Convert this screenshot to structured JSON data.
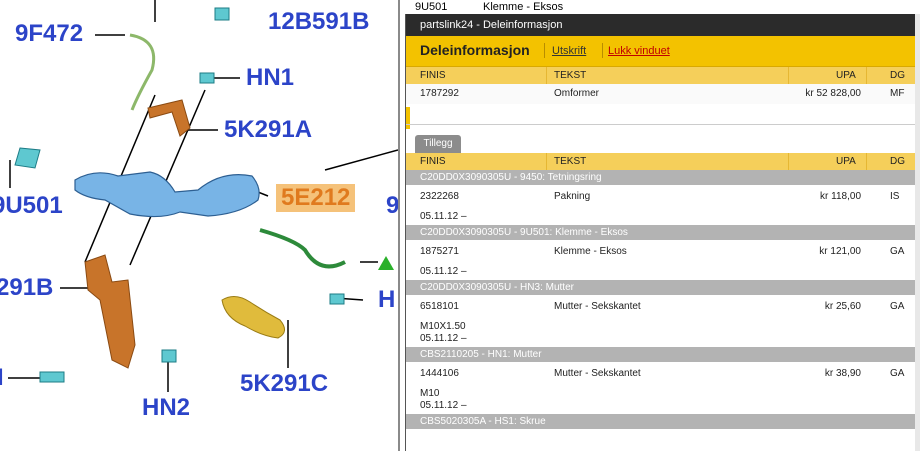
{
  "diagram": {
    "labels": {
      "9f472": "9F472",
      "12b591b": "12B591B",
      "hn1": "HN1",
      "5k291a": "5K291A",
      "9u501": "9U501",
      "5e212": "5E212",
      "9_edge": "9",
      "291b": "291B",
      "hn_right": "H",
      "5k291c": "5K291C",
      "hn2": "HN2",
      "i_left": "I"
    }
  },
  "background_row": {
    "code": "9U501",
    "text": "Klemme - Eksos"
  },
  "popup": {
    "title": "partslink24 - Deleinformasjon",
    "heading": "Deleinformasjon",
    "print_link": "Utskrift",
    "close_link": "Lukk vinduet",
    "columns": {
      "finis": "FINIS",
      "tekst": "TEKST",
      "upa": "UPA",
      "dg": "DG"
    },
    "main_row": {
      "finis": "1787292",
      "tekst": "Omformer",
      "upa": "kr 52 828,00",
      "dg": "MF"
    },
    "tab": "Tillegg",
    "groups": [
      {
        "header": "C20DD0X3090305U - 9450: Tetningsring",
        "finis": "2322268",
        "tekst": "Pakning",
        "upa": "kr 118,00",
        "dg": "IS",
        "notes": [
          "05.11.12 –"
        ]
      },
      {
        "header": "C20DD0X3090305U - 9U501: Klemme - Eksos",
        "finis": "1875271",
        "tekst": "Klemme - Eksos",
        "upa": "kr 121,00",
        "dg": "GA",
        "notes": [
          "05.11.12 –"
        ]
      },
      {
        "header": "C20DD0X3090305U - HN3: Mutter",
        "finis": "6518101",
        "tekst": "Mutter - Sekskantet",
        "upa": "kr 25,60",
        "dg": "GA",
        "notes": [
          "M10X1.50",
          "05.11.12 –"
        ]
      },
      {
        "header": "CBS2110205 - HN1: Mutter",
        "finis": "1444106",
        "tekst": "Mutter - Sekskantet",
        "upa": "kr 38,90",
        "dg": "GA",
        "notes": [
          "M10",
          "05.11.12 –"
        ]
      }
    ],
    "last_group_header": "CBS5020305A - HS1: Skrue"
  }
}
